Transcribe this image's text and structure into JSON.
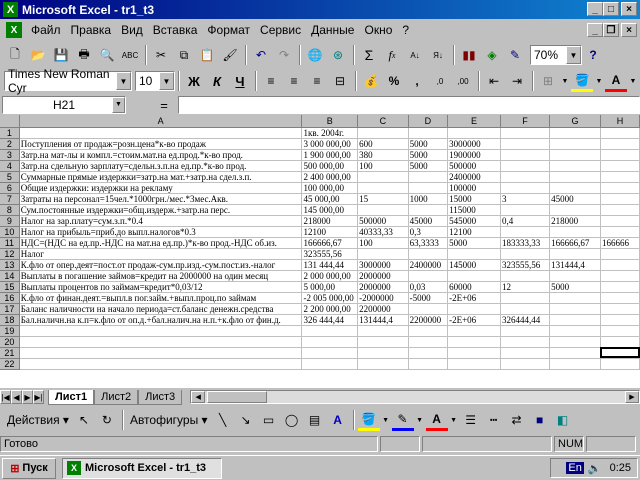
{
  "window": {
    "title": "Microsoft Excel - tr1_t3"
  },
  "menu": [
    "Файл",
    "Правка",
    "Вид",
    "Вставка",
    "Формат",
    "Сервис",
    "Данные",
    "Окно",
    "?"
  ],
  "toolbar": {
    "zoom": "70%"
  },
  "format": {
    "font": "Times New Roman Cyr",
    "size": "10",
    "bold": "Ж",
    "italic": "К",
    "underline": "Ч",
    "percent": "%",
    "comma": ",",
    "ds1": ",0",
    "ds2": ",00"
  },
  "namebox": "H21",
  "formula_eq": "=",
  "columns": [
    "A",
    "B",
    "C",
    "D",
    "E",
    "F",
    "G",
    "H"
  ],
  "rows": [
    [
      "1",
      "",
      "1кв. 2004г.",
      "",
      "",
      "",
      "",
      "",
      ""
    ],
    [
      "2",
      "Поступления от продаж=розн.цена*к-во продаж",
      "3 000 000,00",
      "600",
      "5000",
      "3000000",
      "",
      "",
      ""
    ],
    [
      "3",
      "   Затр.на мат-лы и компл.=стоим.мат.на ед.прод.*к-во прод.",
      "1 900 000,00",
      "380",
      "5000",
      "1900000",
      "",
      "",
      ""
    ],
    [
      "4",
      "   Затр.на сдельную зарплату=сдельн.з.п.на ед.пр.*к-во прод.",
      "500 000,00",
      "100",
      "5000",
      "500000",
      "",
      "",
      ""
    ],
    [
      "5",
      "Суммарные прямые издержки=затр.на мат.+затр.на сдел.з.п.",
      "2 400 000,00",
      "",
      "",
      "2400000",
      "",
      "",
      ""
    ],
    [
      "6",
      "   Общие издержки: издержки на рекламу",
      "100 000,00",
      "",
      "",
      "100000",
      "",
      "",
      ""
    ],
    [
      "7",
      "Затраты на персонал=15чел.*1000грн./мес.*3мес.Акв.",
      "45 000,00",
      "15",
      "1000",
      "15000",
      "3",
      "45000",
      ""
    ],
    [
      "8",
      "Сум.постоянные издержки=общ.издерж.+затр.на перс.",
      "145 000,00",
      "",
      "",
      "115000",
      "",
      "",
      ""
    ],
    [
      "9",
      "Налог на зар.плату=сум.з.п.*0.4",
      "218000",
      "500000",
      "45000",
      "545000",
      "0,4",
      "218000",
      ""
    ],
    [
      "10",
      "Налог на прибыль=приб.до выпл.налогов*0.3",
      "12100",
      "40333,33",
      "0,3",
      "12100",
      "",
      "",
      ""
    ],
    [
      "11",
      "НДС=(НДС на ед.пр.-НДС на мат.на ед.пр.)*к-во прод.-НДС об.из.",
      "166666,67",
      "100",
      "63,3333",
      "5000",
      "183333,33",
      "166666,67",
      "166666"
    ],
    [
      "12",
      "Налог",
      "323555,56",
      "",
      "",
      "",
      "",
      "",
      ""
    ],
    [
      "13",
      "К.фло от опер.деят=пост.от продаж-сум.пр.изд.-сум.пост.из.-налог",
      "131 444,44",
      "3000000",
      "2400000",
      "145000",
      "323555,56",
      "131444,4",
      ""
    ],
    [
      "14",
      "   Выплаты в погашение займов=кредит на 2000000 на один месяц",
      "2 000 000,00",
      "2000000",
      "",
      "",
      "",
      "",
      ""
    ],
    [
      "15",
      "   Выплаты процентов по займам=кредит*0,03/12",
      "5 000,00",
      "2000000",
      "0,03",
      "60000",
      "12",
      "5000",
      ""
    ],
    [
      "16",
      "К.фло от финан.деят.=выпл.в пог.займ.+выпл.проц.по займам",
      "-2 005 000,00",
      "-2000000",
      "-5000",
      "-2Е+06",
      "",
      "",
      ""
    ],
    [
      "17",
      "   Баланс наличности на начало периода=ст.баланс денежн.средства",
      "2 200 000,00",
      "2200000",
      "",
      "",
      "",
      "",
      ""
    ],
    [
      "18",
      "Бал.наличн.на к.п=к.фло от оп.д.+бал.налич.на н.п.+к.фло от фин.д.",
      "326 444,44",
      "131444,4",
      "2200000",
      "-2Е+06",
      "326444,44",
      "",
      ""
    ],
    [
      "19",
      "",
      "",
      "",
      "",
      "",
      "",
      "",
      ""
    ],
    [
      "20",
      "",
      "",
      "",
      "",
      "",
      "",
      "",
      ""
    ],
    [
      "21",
      "",
      "",
      "",
      "",
      "",
      "",
      "",
      ""
    ],
    [
      "22",
      "",
      "",
      "",
      "",
      "",
      "",
      "",
      ""
    ]
  ],
  "sheets": [
    "Лист1",
    "Лист2",
    "Лист3"
  ],
  "draw": {
    "actions": "Действия",
    "autoshapes": "Автофигуры"
  },
  "status": {
    "ready": "Готово",
    "num": "NUM"
  },
  "taskbar": {
    "start": "Пуск",
    "item": "Microsoft Excel - tr1_t3",
    "lang": "En",
    "time": "0:25"
  }
}
